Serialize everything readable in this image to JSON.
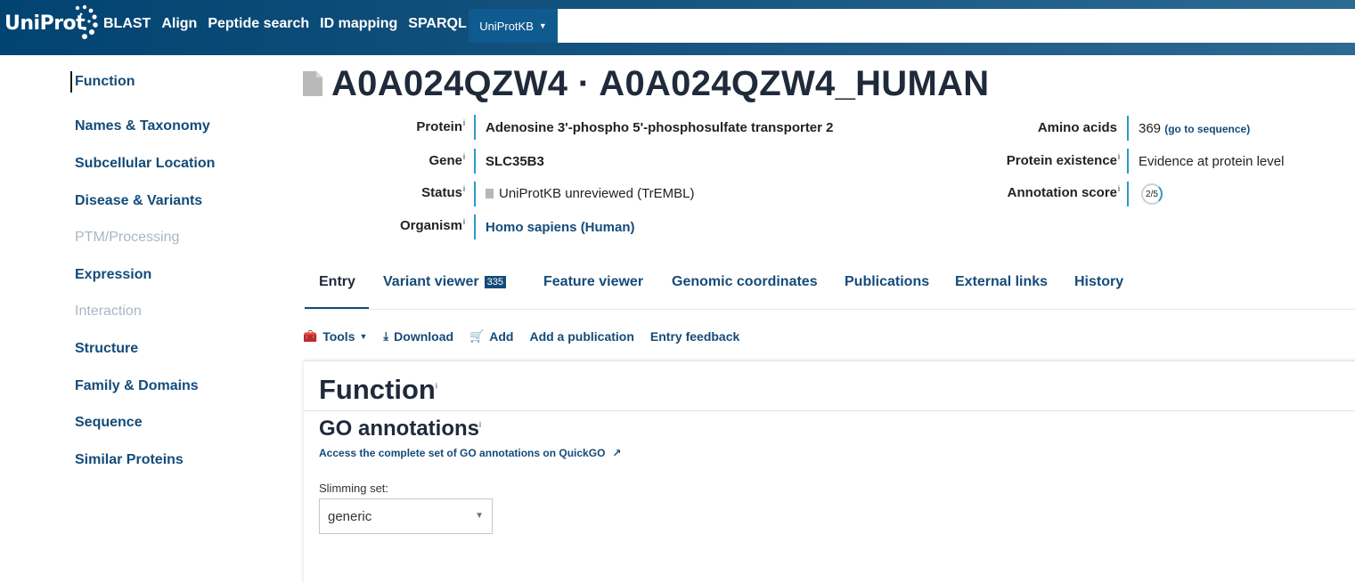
{
  "header": {
    "logo": "UniProt",
    "nav": [
      "BLAST",
      "Align",
      "Peptide search",
      "ID mapping",
      "SPARQL"
    ],
    "database": "UniProtKB",
    "search_value": ""
  },
  "sidebar": {
    "items": [
      {
        "label": "Function",
        "state": "active"
      },
      {
        "label": "Names & Taxonomy",
        "state": "enabled"
      },
      {
        "label": "Subcellular Location",
        "state": "enabled"
      },
      {
        "label": "Disease & Variants",
        "state": "enabled"
      },
      {
        "label": "PTM/Processing",
        "state": "disabled"
      },
      {
        "label": "Expression",
        "state": "enabled"
      },
      {
        "label": "Interaction",
        "state": "disabled"
      },
      {
        "label": "Structure",
        "state": "enabled"
      },
      {
        "label": "Family & Domains",
        "state": "enabled"
      },
      {
        "label": "Sequence",
        "state": "enabled"
      },
      {
        "label": "Similar Proteins",
        "state": "enabled"
      }
    ]
  },
  "entry": {
    "title": "A0A024QZW4 · A0A024QZW4_HUMAN",
    "info_marker": "i",
    "protein_label": "Protein",
    "protein_value": "Adenosine 3'-phospho 5'-phosphosulfate transporter 2",
    "gene_label": "Gene",
    "gene_value": "SLC35B3",
    "status_label": "Status",
    "status_value": "UniProtKB unreviewed (TrEMBL)",
    "organism_label": "Organism",
    "organism_value": "Homo sapiens (Human)",
    "amino_label": "Amino acids",
    "amino_value": "369",
    "amino_link": "(go to sequence)",
    "existence_label": "Protein existence",
    "existence_value": "Evidence at protein level",
    "score_label": "Annotation score",
    "score_value": "2/5"
  },
  "tabs": {
    "entry": "Entry",
    "variant": "Variant viewer",
    "variant_count": "335",
    "feature": "Feature viewer",
    "genomic": "Genomic coordinates",
    "publications": "Publications",
    "external": "External links",
    "history": "History"
  },
  "toolbar": {
    "tools": "Tools",
    "download": "Download",
    "add": "Add",
    "add_publication": "Add a publication",
    "feedback": "Entry feedback"
  },
  "function_section": {
    "title": "Function",
    "go_title": "GO annotations",
    "quickgo_link": "Access the complete set of GO annotations on QuickGO",
    "slimming_label": "Slimming set:",
    "slimming_value": "generic"
  },
  "colors": {
    "header_start": "#014371",
    "accent": "#144b7a",
    "bar": "#2c99c9"
  }
}
